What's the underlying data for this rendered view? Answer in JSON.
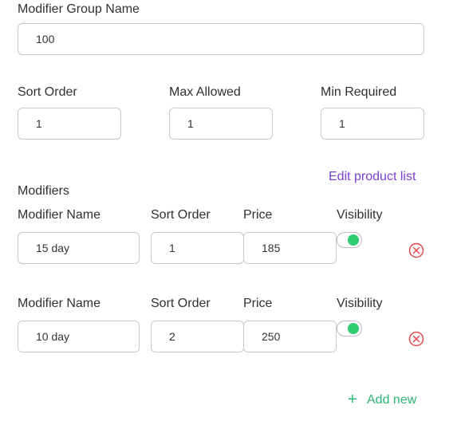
{
  "group": {
    "name_label": "Modifier Group Name",
    "name_value": "100"
  },
  "settings": {
    "sort_order_label": "Sort Order",
    "sort_order_value": "1",
    "max_allowed_label": "Max Allowed",
    "max_allowed_value": "1",
    "min_required_label": "Min Required",
    "min_required_value": "1"
  },
  "modifiers": {
    "section_label": "Modifiers",
    "edit_link": "Edit product list",
    "rows": [
      {
        "name_label": "Modifier Name",
        "sort_label": "Sort Order",
        "price_label": "Price",
        "visibility_label": "Visibility",
        "name": "15 day",
        "sort": "1",
        "price": "185",
        "visible": true
      },
      {
        "name_label": "Modifier Name",
        "sort_label": "Sort Order",
        "price_label": "Price",
        "visibility_label": "Visibility",
        "name": "10 day",
        "sort": "2",
        "price": "250",
        "visible": true
      }
    ],
    "add_new_label": "Add new"
  },
  "colors": {
    "accent_link": "#7a3fd0",
    "toggle_on": "#2ecc71",
    "add_new": "#2bb673",
    "remove_icon": "#e5484d"
  }
}
